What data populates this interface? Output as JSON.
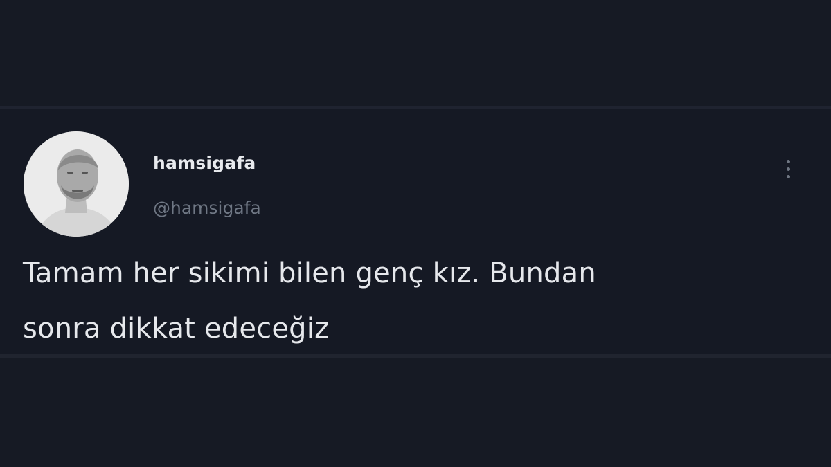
{
  "tweet": {
    "author": {
      "display_name": "hamsigafa",
      "handle": "@hamsigafa",
      "avatar": "profile-photo"
    },
    "text_lines": [
      "Tamam her sikimi bilen genç kız. Bundan",
      "sonra dikkat edeceğiz"
    ],
    "more_icon": "more-vertical-icon"
  },
  "colors": {
    "background": "#161a24",
    "text": "#e6e8ec",
    "handle": "#6f7784"
  }
}
